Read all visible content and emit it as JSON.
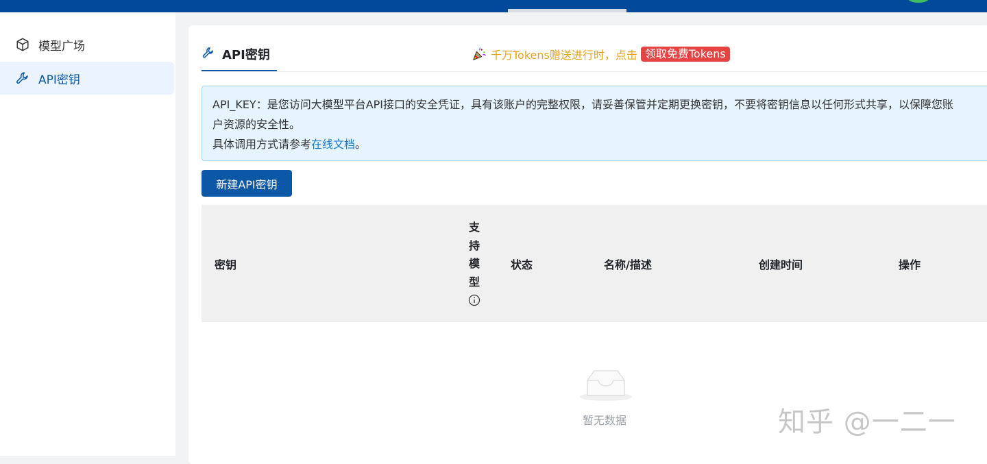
{
  "sidebar": {
    "items": [
      {
        "label": "模型广场",
        "icon": "cube-icon",
        "active": false
      },
      {
        "label": "API密钥",
        "icon": "wrench-icon",
        "active": true
      }
    ]
  },
  "main": {
    "tab": {
      "label": "API密钥",
      "icon": "wrench-icon"
    },
    "promo": {
      "text": "千万Tokens赠送进行时，点击",
      "badge": "领取免费Tokens",
      "icon": "party-popper-icon"
    },
    "notice": {
      "line1": "API_KEY：是您访问大模型平台API接口的安全凭证，具有该账户的完整权限，请妥善保管并定期更换密钥，不要将密钥信息以任何形式共享，以保障您账",
      "line2": "户资源的安全性。",
      "line3_prefix": "具体调用方式请参考",
      "line3_link": "在线文档",
      "line3_suffix": "。"
    },
    "new_button": "新建API密钥",
    "table": {
      "columns": [
        "密钥",
        "支持模型",
        "状态",
        "名称/描述",
        "创建时间",
        "操作"
      ],
      "supported_models_chars": [
        "支",
        "持",
        "模",
        "型"
      ],
      "rows": []
    },
    "empty_text": "暂无数据"
  },
  "watermark": "知乎 @一二一",
  "colors": {
    "topbar": "#004a99",
    "primary": "#0d57a7",
    "promo_text": "#e8a318",
    "promo_badge": "#e64343",
    "notice_bg": "#e6f4ff"
  }
}
